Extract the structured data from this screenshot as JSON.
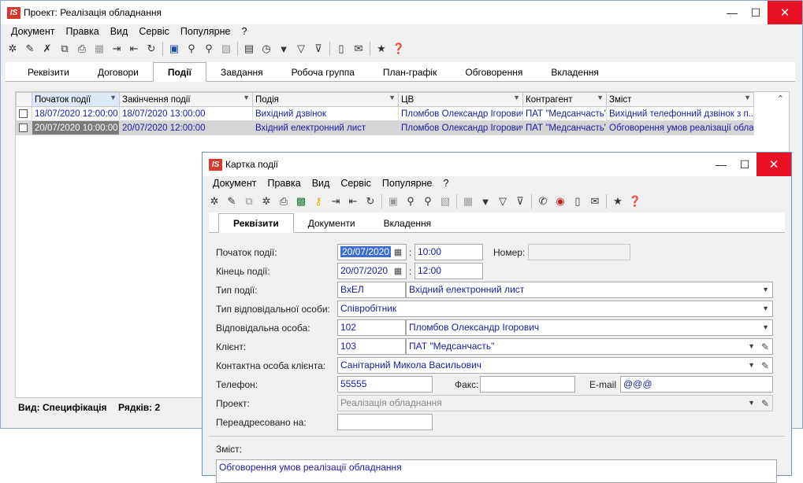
{
  "main": {
    "title": "Проект: Реалізація обладнання",
    "logo": "IS",
    "menu": [
      "Документ",
      "Правка",
      "Вид",
      "Сервіс",
      "Популярне",
      "?"
    ],
    "tabs": [
      "Реквізити",
      "Договори",
      "Події",
      "Завдання",
      "Робоча группа",
      "План-графік",
      "Обговорення",
      "Вкладення"
    ],
    "active_tab": "Події",
    "columns": [
      "Початок події",
      "Закінчення події",
      "Подія",
      "ЦВ",
      "Контрагент",
      "Зміст"
    ],
    "rows": [
      {
        "start": "18/07/2020 12:00:00",
        "end": "18/07/2020 13:00:00",
        "event": "Вихідний дзвінок",
        "cv": "Пломбов Олександр Ігорович",
        "contractor": "ПАТ \"Медсанчасть\"",
        "content": "Вихідний телефонний дзвінок з п..."
      },
      {
        "start": "20/07/2020 10:00:00",
        "end": "20/07/2020 12:00:00",
        "event": "Вхідний електронний лист",
        "cv": "Пломбов Олександр Ігорович",
        "contractor": "ПАТ \"Медсанчасть\"",
        "content": "Обговорення умов реалізації обла..."
      }
    ],
    "status_view": "Вид: Специфікація",
    "status_rows": "Рядків: 2"
  },
  "card": {
    "title": "Картка події",
    "logo": "IS",
    "menu": [
      "Документ",
      "Правка",
      "Вид",
      "Сервіс",
      "Популярне",
      "?"
    ],
    "tabs": [
      "Реквізити",
      "Документи",
      "Вкладення"
    ],
    "active_tab": "Реквізити",
    "labels": {
      "start": "Початок події:",
      "end": "Кінець події:",
      "type": "Тип події:",
      "resp_type": "Тип відповідальної особи:",
      "resp": "Відповідальна особа:",
      "client": "Клієнт:",
      "contact": "Контактна особа клієнта:",
      "phone": "Телефон:",
      "fax": "Факс:",
      "email": "E-mail",
      "project": "Проект:",
      "redirect": "Переадресовано на:",
      "number": "Номер:",
      "content": "Зміст:"
    },
    "values": {
      "start_date": "20/07/2020",
      "start_time": "10:00",
      "end_date": "20/07/2020",
      "end_time": "12:00",
      "number": "",
      "type_code": "ВхЕЛ",
      "type_name": "Вхідний електронний лист",
      "resp_type": "Співробітник",
      "resp_code": "102",
      "resp_name": "Пломбов Олександр Ігорович",
      "client_code": "103",
      "client_name": "ПАТ \"Медсанчасть\"",
      "contact": "Санітарний Микола Васильович",
      "phone": "55555",
      "fax": "",
      "email": "@@@",
      "project": "Реалізація обладнання",
      "redirect": "",
      "content": "Обговорення умов реалізації обладнання"
    }
  }
}
